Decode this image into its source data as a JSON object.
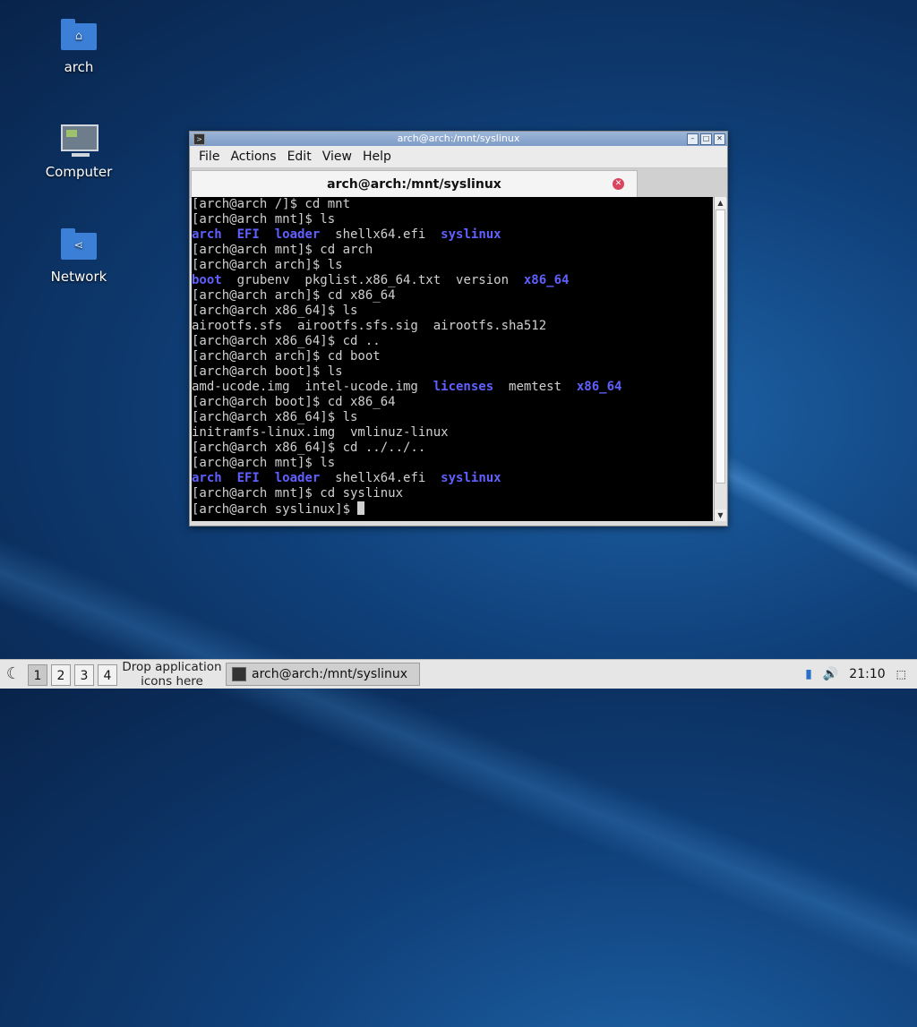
{
  "desktop": {
    "icons": [
      {
        "label": "arch",
        "icon": "home-folder-icon"
      },
      {
        "label": "Computer",
        "icon": "computer-icon"
      },
      {
        "label": "Network",
        "icon": "network-folder-icon"
      }
    ]
  },
  "window": {
    "title": "arch@arch:/mnt/syslinux",
    "menu": [
      "File",
      "Actions",
      "Edit",
      "View",
      "Help"
    ],
    "tab_title": "arch@arch:/mnt/syslinux",
    "terminal_lines": [
      [
        {
          "t": "[arch@arch /]$ cd mnt"
        }
      ],
      [
        {
          "t": "[arch@arch mnt]$ ls"
        }
      ],
      [
        {
          "t": "arch",
          "d": true
        },
        {
          "t": "  "
        },
        {
          "t": "EFI",
          "d": true
        },
        {
          "t": "  "
        },
        {
          "t": "loader",
          "d": true
        },
        {
          "t": "  shellx64.efi  "
        },
        {
          "t": "syslinux",
          "d": true
        }
      ],
      [
        {
          "t": "[arch@arch mnt]$ cd arch"
        }
      ],
      [
        {
          "t": "[arch@arch arch]$ ls"
        }
      ],
      [
        {
          "t": "boot",
          "d": true
        },
        {
          "t": "  grubenv  pkglist.x86_64.txt  version  "
        },
        {
          "t": "x86_64",
          "d": true
        }
      ],
      [
        {
          "t": "[arch@arch arch]$ cd x86_64"
        }
      ],
      [
        {
          "t": "[arch@arch x86_64]$ ls"
        }
      ],
      [
        {
          "t": "airootfs.sfs  airootfs.sfs.sig  airootfs.sha512"
        }
      ],
      [
        {
          "t": "[arch@arch x86_64]$ cd .."
        }
      ],
      [
        {
          "t": "[arch@arch arch]$ cd boot"
        }
      ],
      [
        {
          "t": "[arch@arch boot]$ ls"
        }
      ],
      [
        {
          "t": "amd-ucode.img  intel-ucode.img  "
        },
        {
          "t": "licenses",
          "d": true
        },
        {
          "t": "  memtest  "
        },
        {
          "t": "x86_64",
          "d": true
        }
      ],
      [
        {
          "t": "[arch@arch boot]$ cd x86_64"
        }
      ],
      [
        {
          "t": "[arch@arch x86_64]$ ls"
        }
      ],
      [
        {
          "t": "initramfs-linux.img  vmlinuz-linux"
        }
      ],
      [
        {
          "t": "[arch@arch x86_64]$ cd ../../.."
        }
      ],
      [
        {
          "t": "[arch@arch mnt]$ ls"
        }
      ],
      [
        {
          "t": "arch",
          "d": true
        },
        {
          "t": "  "
        },
        {
          "t": "EFI",
          "d": true
        },
        {
          "t": "  "
        },
        {
          "t": "loader",
          "d": true
        },
        {
          "t": "  shellx64.efi  "
        },
        {
          "t": "syslinux",
          "d": true
        }
      ],
      [
        {
          "t": "[arch@arch mnt]$ cd syslinux"
        }
      ],
      [
        {
          "t": "[arch@arch syslinux]$ "
        }
      ]
    ]
  },
  "taskbar": {
    "workspaces": [
      "1",
      "2",
      "3",
      "4"
    ],
    "active_workspace": "1",
    "drop_hint": "Drop application icons here",
    "task_label": "arch@arch:/mnt/syslinux",
    "clock": "21:10"
  }
}
